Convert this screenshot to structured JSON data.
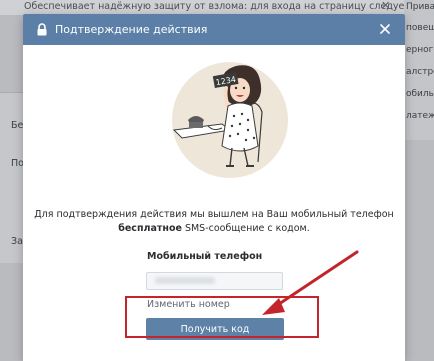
{
  "background": {
    "top_text": "Обеспечивает надёжную защиту от взлома: для входа на страницу следует",
    "top_close": "✕",
    "right_items": [
      "Приват",
      "повещ",
      "ерного",
      "алстро",
      "обильн",
      "латеж"
    ],
    "left_letters": [
      "Бе",
      "По",
      "Зап"
    ]
  },
  "modal": {
    "title": "Подтверждение действия",
    "description_line1": "Для подтверждения действия мы вышлем на Ваш мобильный телефон",
    "description_bold": "бесплатное",
    "description_line2_rest": " SMS-сообщение с кодом.",
    "phone_label": "Мобильный телефон",
    "phone_value": "",
    "change_number_link": "Изменить номер",
    "submit_button": "Получить код",
    "illustration_badge": "1234"
  },
  "colors": {
    "header": "#5b7fa6",
    "button": "#5e81a8",
    "annotation": "#c4242b"
  },
  "icons": [
    "lock-icon",
    "close-icon",
    "phone-illustration",
    "annotation-arrow"
  ]
}
